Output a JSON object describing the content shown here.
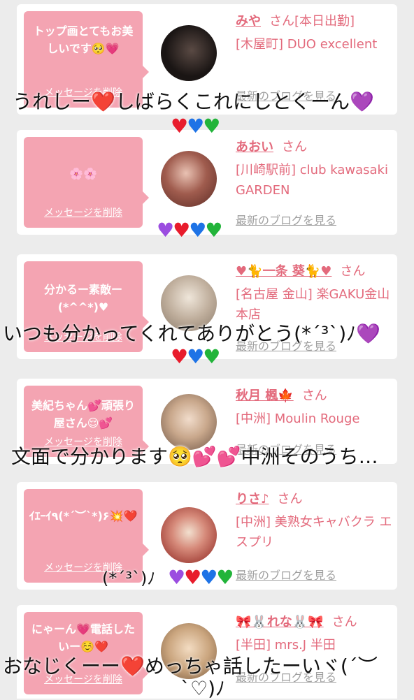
{
  "cards": [
    {
      "message": "トップ画とてもお美しいです🥺💗",
      "delete_label": "メッセージを削除",
      "name": "みや",
      "suffix": "さん[本日出勤]",
      "shop": "[木屋町] DUO excellent",
      "blog": "最新のブログを見る",
      "avatar_color": "#1a1514"
    },
    {
      "message": "🌸🌸",
      "delete_label": "メッセージを削除",
      "name": "あおい",
      "suffix": "さん",
      "shop": "[川崎駅前] club kawasaki GARDEN",
      "blog": "最新のブログを見る",
      "avatar_color": "#7a3f3a"
    },
    {
      "message": "分かるー素敵ー(*^^*)♥",
      "delete_label": "メッセージを削除",
      "name": "♥🐈一条 葵🐈♥",
      "suffix": "さん",
      "shop": "[名古屋 金山] 楽GAKU金山本店",
      "blog": "最新のブログを見る",
      "avatar_color": "#b9a99a"
    },
    {
      "message": "美紀ちゃん💕頑張り屋さん😌💕",
      "delete_label": "メッセージを削除",
      "name": "秋月 楓🍁",
      "suffix": "さん",
      "shop": "[中洲] Moulin Rouge",
      "blog": "最新のブログを見る",
      "avatar_color": "#c9b6a6"
    },
    {
      "message": "ｲｴｰｲ٩(*´︶`*)۶💥❤️",
      "delete_label": "メッセージを削除",
      "name": "りさ♪",
      "suffix": "さん",
      "shop": "[中洲] 美熟女キャバクラ エスプリ",
      "blog": "最新のブログを見る",
      "avatar_color": "#b8342c"
    },
    {
      "message": "にゃーん💗電話したいー☺️❤️",
      "delete_label": "メッセージを削除",
      "name": "🎀🐰れな🐰🎀",
      "suffix": "さん",
      "shop": "[半田] mrs.J 半田",
      "blog": "最新のブログを見る",
      "avatar_color": "#caa57e"
    }
  ],
  "overlays": {
    "line1": "うれしー❤️しばらくこれにしとくーん💜",
    "line2": "いつも分かってくれてありがとう(*´³`)ﾉ💜",
    "line3": "文面で分かります🥺💕💕中洲そのうち…",
    "line4": "(*´³`)ﾉ",
    "line5": "おなじくーー❤️めっちゃ話したーいヾ(´︶",
    "line6": "`♡)ﾉ"
  },
  "colors": {
    "accent": "#e36a7c",
    "bubble": "#f4a4b2",
    "link_gray": "#a0a0a0",
    "background": "#ececec"
  }
}
